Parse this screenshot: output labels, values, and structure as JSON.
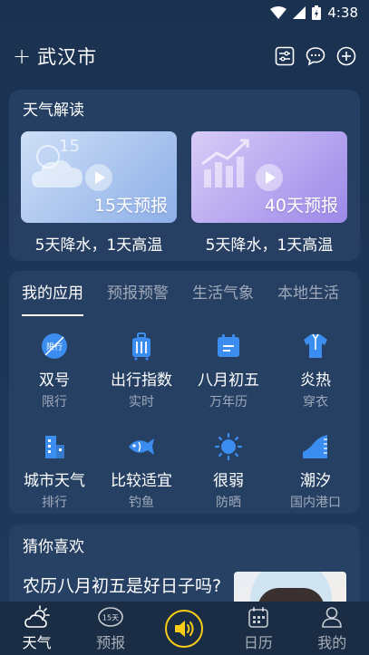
{
  "status_bar": {
    "time": "4:38"
  },
  "header": {
    "city": "武汉市",
    "add_city_glyph": "+"
  },
  "weather_reading": {
    "title": "天气解读",
    "items": [
      {
        "banner_label": "15天预报",
        "banner_number": "15",
        "caption": "5天降水，1天高温",
        "color": "#a9c4ee"
      },
      {
        "banner_label": "40天预报",
        "caption": "5天降水，1天高温",
        "color": "#b7a6f0"
      }
    ]
  },
  "apps_section": {
    "tabs": [
      "我的应用",
      "预报预警",
      "生活气象",
      "本地生活"
    ],
    "active_tab": 0,
    "apps": [
      {
        "name": "双号",
        "sub": "限行",
        "icon_text": "限行",
        "icon": "traffic-restriction-icon",
        "color": "#3b8ef0"
      },
      {
        "name": "出行指数",
        "sub": "实时",
        "icon": "luggage-icon",
        "color": "#3b8ef0"
      },
      {
        "name": "八月初五",
        "sub": "万年历",
        "icon": "calendar-icon",
        "color": "#3b8ef0"
      },
      {
        "name": "炎热",
        "sub": "穿衣",
        "icon": "clothing-icon",
        "color": "#3b8ef0"
      },
      {
        "name": "城市天气",
        "sub": "排行",
        "icon": "city-ranking-icon",
        "color": "#3b8ef0"
      },
      {
        "name": "比较适宜",
        "sub": "钓鱼",
        "icon": "fish-icon",
        "color": "#3b8ef0"
      },
      {
        "name": "很弱",
        "sub": "防晒",
        "icon": "sun-icon",
        "color": "#3b8ef0"
      },
      {
        "name": "潮汐",
        "sub": "国内港口",
        "icon": "tide-icon",
        "color": "#3b8ef0"
      }
    ]
  },
  "recommend": {
    "title": "猜你喜欢",
    "article_title": "农历八月初五是好日子吗?"
  },
  "bottom_nav": {
    "items": [
      {
        "label": "天气",
        "icon": "weather-icon",
        "active": true
      },
      {
        "label": "预报",
        "icon": "forecast-15-icon",
        "icon_text": "15天"
      },
      {
        "label": "",
        "icon": "sound-icon",
        "accent": "#f6cc16"
      },
      {
        "label": "日历",
        "icon": "calendar-icon"
      },
      {
        "label": "我的",
        "icon": "profile-icon"
      }
    ]
  }
}
